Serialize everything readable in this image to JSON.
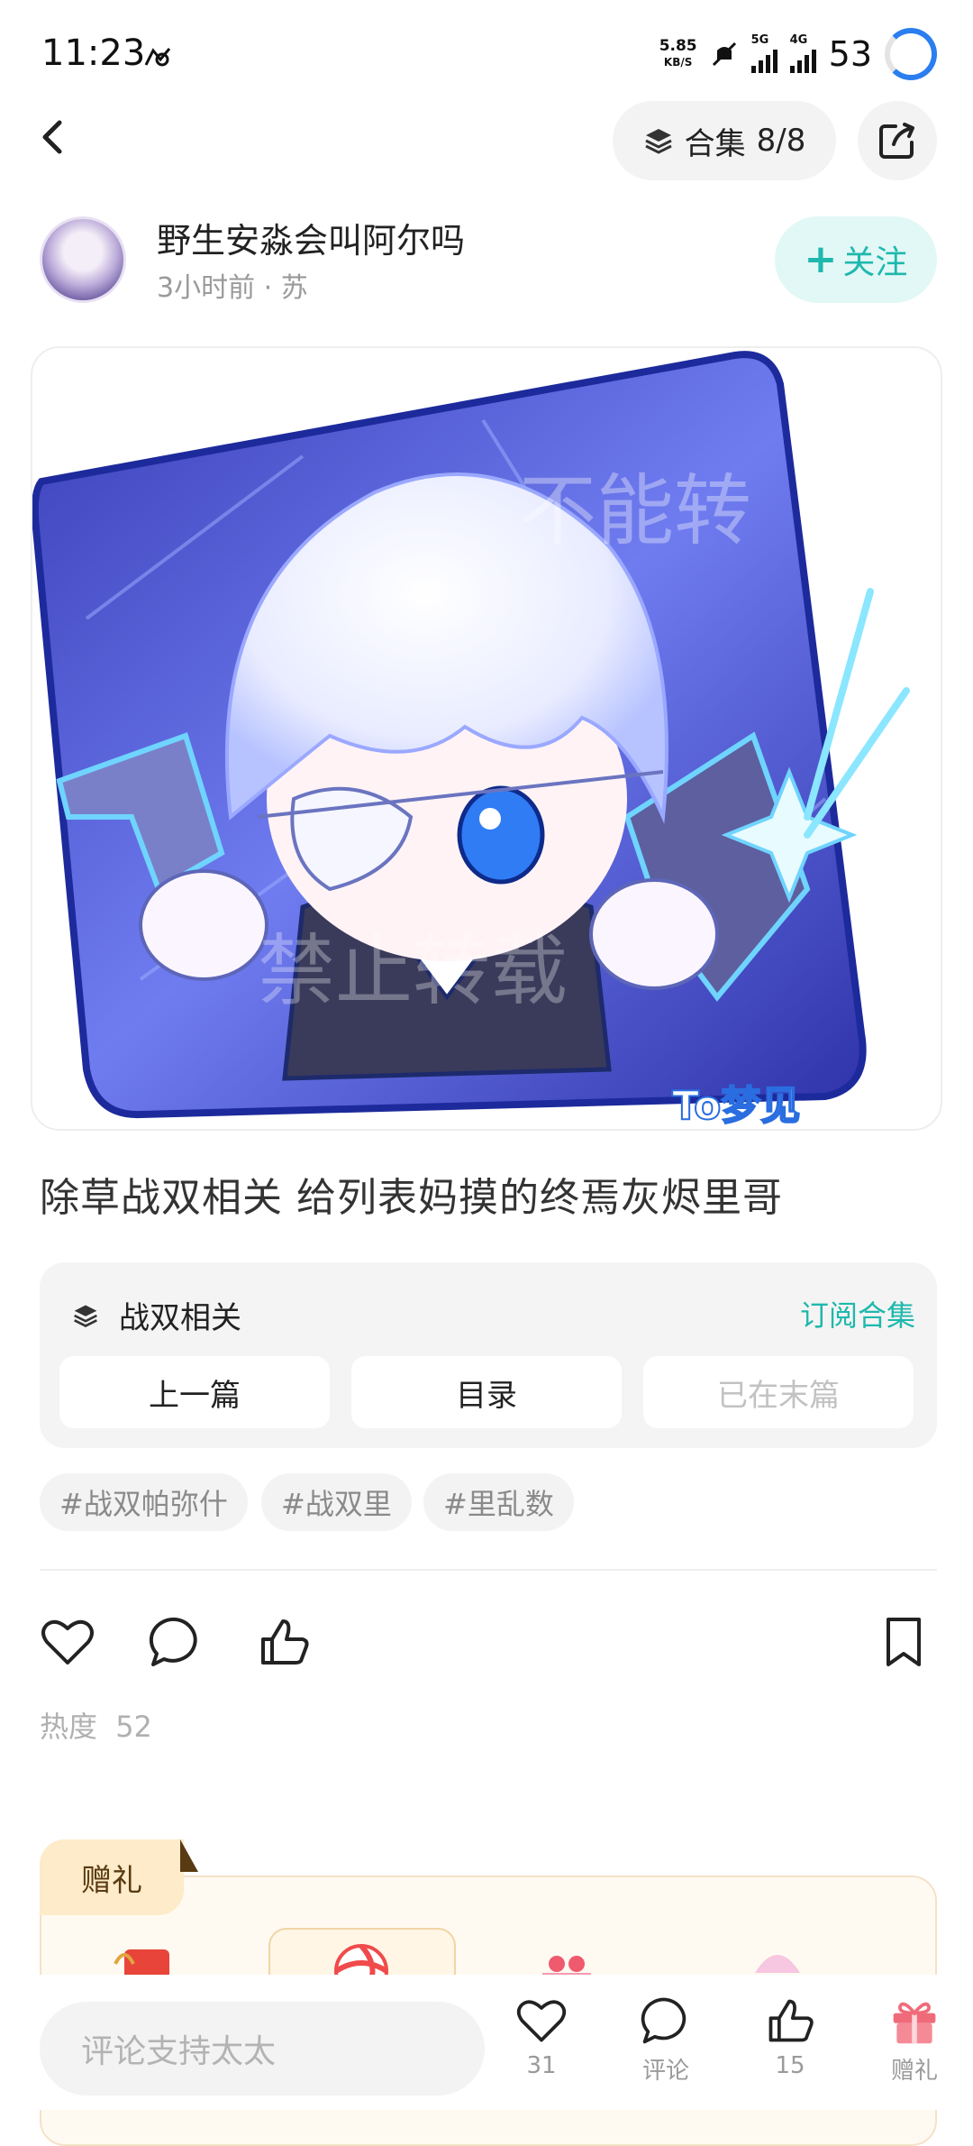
{
  "status_bar": {
    "time": "11:23",
    "net_speed_value": "5.85",
    "net_speed_unit": "KB/S",
    "signal1_label": "5G",
    "signal2_label": "4G",
    "battery": "53"
  },
  "header": {
    "collection_label": "合集",
    "collection_progress": "8/8"
  },
  "author": {
    "name": "野生安淼会叫阿尔吗",
    "meta": "3小时前 · 苏",
    "follow_label": "关注",
    "follow_plus": "+"
  },
  "artwork": {
    "signature": "To梦见"
  },
  "post": {
    "title": "除草战双相关 给列表妈摸的终焉灰烬里哥"
  },
  "collection_card": {
    "name": "战双相关",
    "subscribe_label": "订阅合集",
    "prev_label": "上一篇",
    "toc_label": "目录",
    "last_label": "已在末篇"
  },
  "tags": [
    "#战双帕弥什",
    "#战双里",
    "#里乱数"
  ],
  "stats": {
    "heat_label": "热度",
    "heat_value": "52"
  },
  "gift": {
    "tab_label": "赠礼"
  },
  "bottom_bar": {
    "comment_placeholder": "评论支持太太",
    "like_count": "31",
    "comment_label": "评论",
    "thumb_count": "15",
    "gift_label": "赠礼"
  },
  "colors": {
    "accent": "#1fb8ad",
    "follow_bg": "#e2f8f6",
    "gift_red": "#f06b7a",
    "loading_blue": "#2a7ef0"
  },
  "icons": [
    "back-arrow-icon",
    "layers-icon",
    "share-icon",
    "heart-icon",
    "comment-icon",
    "thumbs-up-icon",
    "bookmark-icon",
    "gift-icon",
    "camera-icon",
    "signal-icon",
    "mute-icon"
  ]
}
